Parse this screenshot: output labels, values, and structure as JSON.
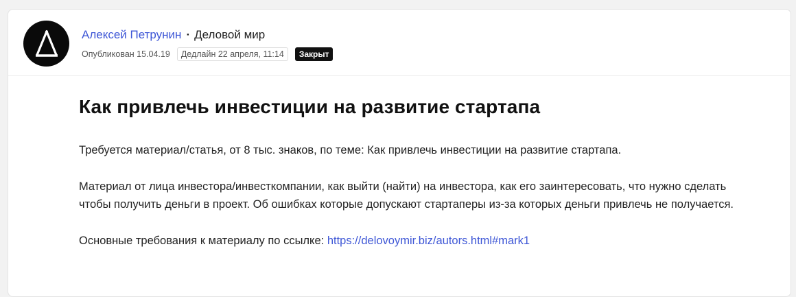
{
  "post": {
    "author": "Алексей Петрунин",
    "separator": "·",
    "company": "Деловой мир",
    "published": "Опубликован 15.04.19",
    "deadline": "Дедлайн 22 апреля, 11:14",
    "status": "Закрыт",
    "title": "Как привлечь инвестиции на развитие стартапа",
    "paragraph1": "Требуется материал/статья, от 8 тыс. знаков, по теме: Как привлечь инвестиции на развитие стартапа.",
    "paragraph2": "Материал от лица инвестора/инвесткомпании, как выйти (найти) на инвестора, как его заинтересовать, что нужно сделать чтобы получить деньги в проект. Об ошибках которые допускают стартаперы из-за которых деньги привлечь не получается.",
    "paragraph3_prefix": "Основные требования к материалу по ссылке: ",
    "link_text": "https://delovoymir.biz/autors.html#mark1"
  },
  "colors": {
    "link": "#3d56d6",
    "badge_bg": "#111111",
    "avatar_bg": "#0a0a0a"
  },
  "icons": {
    "avatar": "delta-logo-icon"
  }
}
